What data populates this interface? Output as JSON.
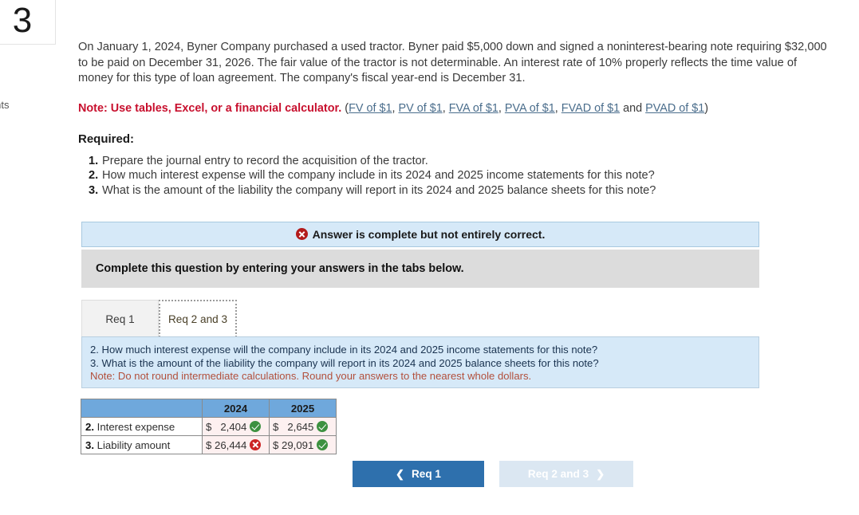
{
  "question": {
    "number": "3",
    "points_label": "oints"
  },
  "prompt": {
    "text": "On January 1, 2024, Byner Company purchased a used tractor. Byner paid $5,000 down and signed a noninterest-bearing note requiring $32,000 to be paid on December 31, 2026. The fair value of the tractor is not determinable. An interest rate of 10% properly reflects the time value of money for this type of loan agreement. The company's fiscal year-end is December 31."
  },
  "note": {
    "bold_text": "Note: Use tables, Excel, or a financial calculator.",
    "open_paren": " (",
    "links": [
      "FV of $1",
      "PV of $1",
      "FVA of $1",
      "PVA of $1",
      "FVAD of $1",
      "PVAD of $1"
    ],
    "separator": ", ",
    "and_word": " and ",
    "close_paren": ")"
  },
  "required": {
    "heading": "Required:",
    "items": [
      "Prepare the journal entry to record the acquisition of the tractor.",
      "How much interest expense will the company include in its 2024 and 2025 income statements for this note?",
      "What is the amount of the liability the company will report in its 2024 and 2025 balance sheets for this note?"
    ]
  },
  "alert": {
    "icon": "error-x-icon",
    "text": "Answer is complete but not entirely correct.",
    "background_color": "#d6e9f8",
    "icon_color": "#b31b1b"
  },
  "instruction": {
    "text": "Complete this question by entering your answers in the tabs below.",
    "background_color": "#dcdcdc"
  },
  "tabs": {
    "items": [
      {
        "label": "Req 1",
        "active": false
      },
      {
        "label": "Req 2 and 3",
        "active": true
      }
    ]
  },
  "requirement_panel": {
    "line1": "2. How much interest expense will the company include in its 2024 and 2025 income statements for this note?",
    "line2": "3. What is the amount of the liability the company will report in its 2024 and 2025 balance sheets for this note?",
    "note": "Note: Do not round intermediate calculations. Round your answers to the nearest whole dollars.",
    "background_color": "#d6e9f8",
    "note_color": "#b2503c"
  },
  "answer_table": {
    "header_color": "#6fa8dc",
    "columns": [
      "",
      "2024",
      "2025"
    ],
    "rows": [
      {
        "number": "2.",
        "label": " Interest expense",
        "cells": [
          {
            "currency": "$",
            "value": "2,404",
            "status": "correct"
          },
          {
            "currency": "$",
            "value": "2,645",
            "status": "correct"
          }
        ]
      },
      {
        "number": "3.",
        "label": " Liability amount",
        "cells": [
          {
            "currency": "$",
            "value": "26,444",
            "status": "incorrect"
          },
          {
            "currency": "$",
            "value": "29,091",
            "status": "correct"
          }
        ]
      }
    ]
  },
  "navigation": {
    "prev": {
      "label": "Req 1",
      "icon": "chevron-left-icon",
      "enabled": true,
      "color": "#2e70ad"
    },
    "next": {
      "label": "Req 2 and 3",
      "icon": "chevron-right-icon",
      "enabled": false,
      "color": "#dbe7f2"
    }
  }
}
